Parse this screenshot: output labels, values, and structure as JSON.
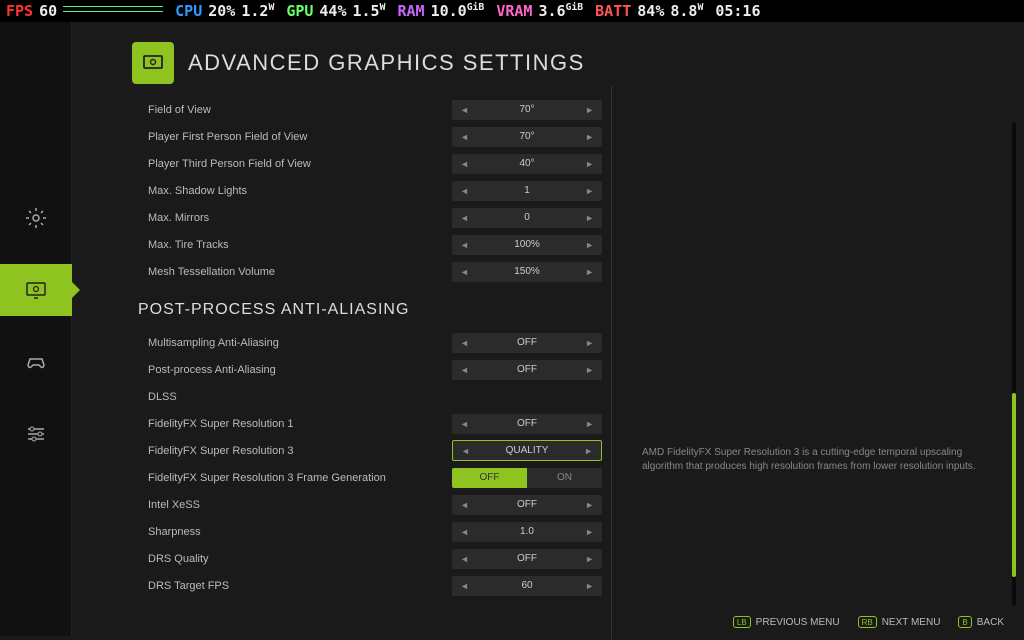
{
  "overlay": {
    "fps": {
      "label": "FPS",
      "value": "60"
    },
    "cpu": {
      "label": "CPU",
      "pct": "20%",
      "watt": "1.2"
    },
    "gpu": {
      "label": "GPU",
      "pct": "44%",
      "watt": "1.5"
    },
    "ram": {
      "label": "RAM",
      "val": "10.0"
    },
    "vram": {
      "label": "VRAM",
      "val": "3.6"
    },
    "batt": {
      "label": "BATT",
      "pct": "84%",
      "watt": "8.8"
    },
    "time": "05:16"
  },
  "header": {
    "title": "ADVANCED GRAPHICS SETTINGS"
  },
  "group1": [
    {
      "label": "Field of View",
      "value": "70°"
    },
    {
      "label": "Player First Person Field of View",
      "value": "70°"
    },
    {
      "label": "Player Third Person Field of View",
      "value": "40°"
    },
    {
      "label": "Max. Shadow Lights",
      "value": "1"
    },
    {
      "label": "Max. Mirrors",
      "value": "0"
    },
    {
      "label": "Max. Tire Tracks",
      "value": "100%"
    },
    {
      "label": "Mesh Tessellation Volume",
      "value": "150%"
    }
  ],
  "section2": {
    "title": "POST-PROCESS ANTI-ALIASING"
  },
  "group2a": [
    {
      "label": "Multisampling Anti-Aliasing",
      "value": "OFF"
    },
    {
      "label": "Post-process Anti-Aliasing",
      "value": "OFF"
    }
  ],
  "dlss": {
    "label": "DLSS"
  },
  "fsr1": {
    "label": "FidelityFX Super Resolution 1",
    "value": "OFF"
  },
  "fsr3": {
    "label": "FidelityFX Super Resolution 3",
    "value": "QUALITY"
  },
  "fsr3fg": {
    "label": "FidelityFX Super Resolution 3 Frame Generation",
    "off": "OFF",
    "on": "ON"
  },
  "group2b": [
    {
      "label": "Intel XeSS",
      "value": "OFF"
    },
    {
      "label": "Sharpness",
      "value": "1.0"
    },
    {
      "label": "DRS Quality",
      "value": "OFF"
    },
    {
      "label": "DRS Target FPS",
      "value": "60"
    }
  ],
  "desc": "AMD FidelityFX Super Resolution 3 is a cutting-edge temporal upscaling algorithm that produces high resolution frames from lower resolution inputs.",
  "footer": {
    "prev": "PREVIOUS MENU",
    "next": "NEXT MENU",
    "back": "BACK",
    "lb": "LB",
    "rb": "RB",
    "btn": "B"
  }
}
